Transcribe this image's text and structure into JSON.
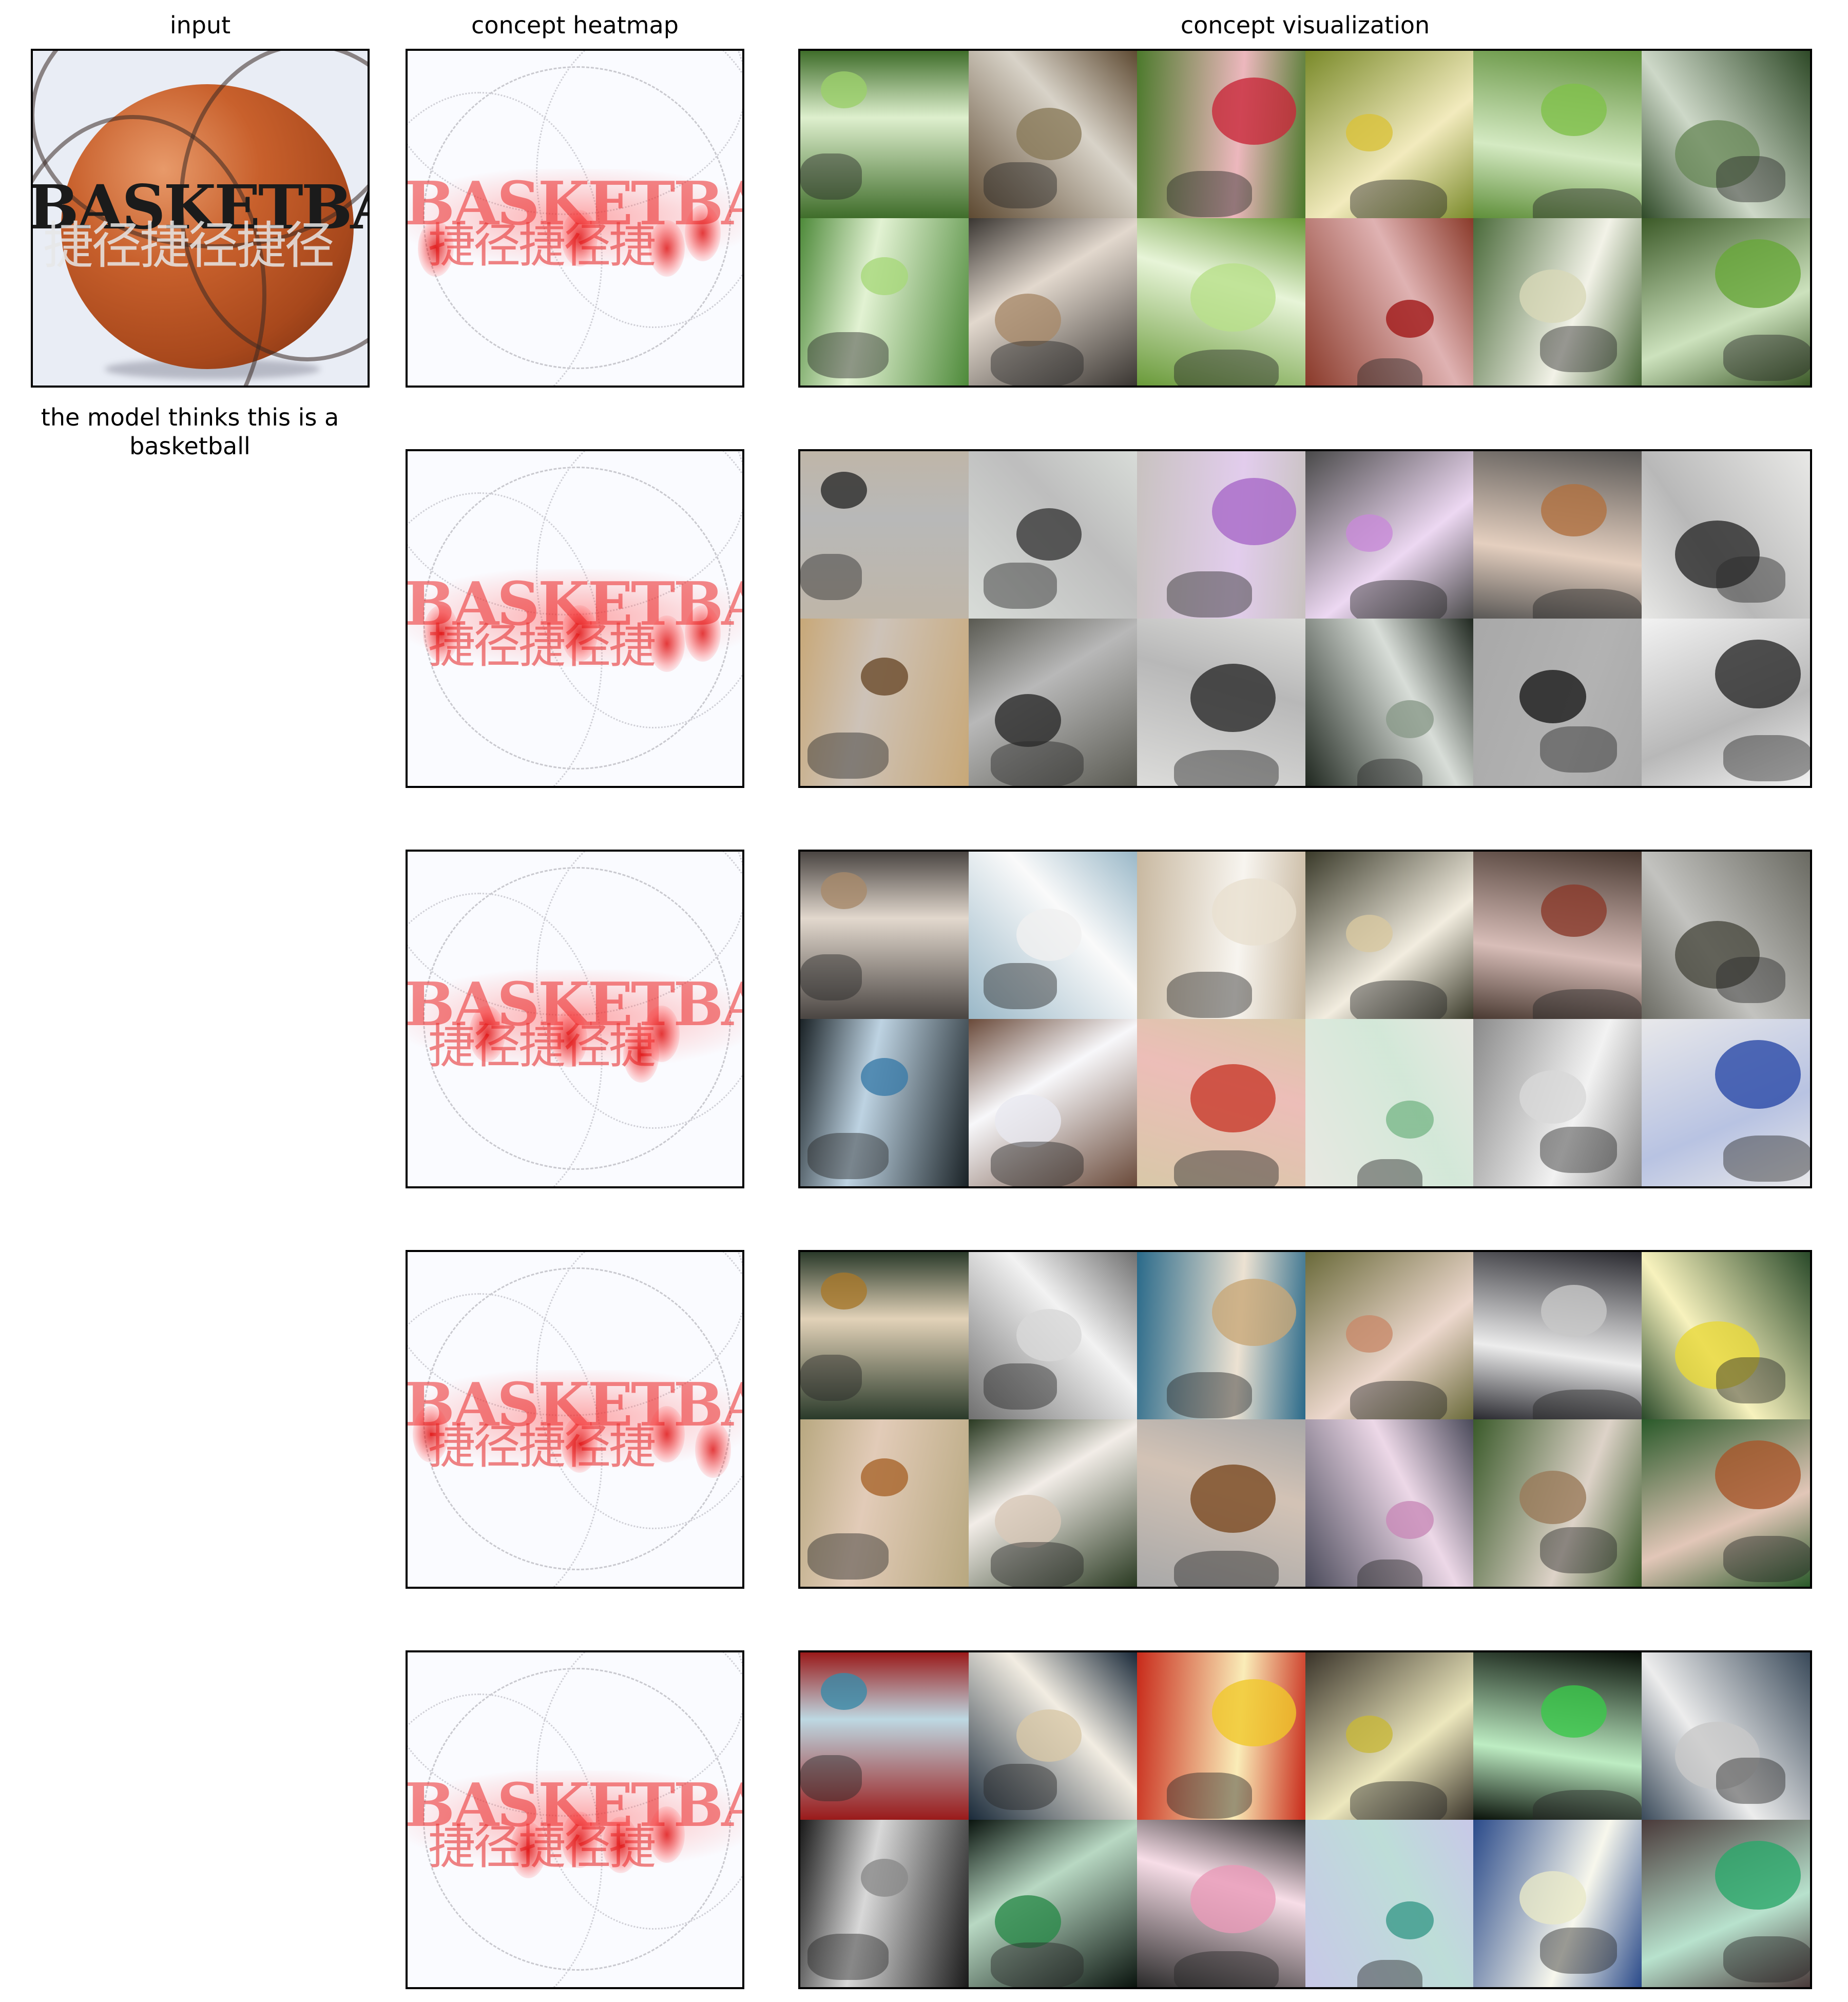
{
  "titles": {
    "input": "input",
    "heatmap": "concept heatmap",
    "visualization": "concept visualization"
  },
  "caption": "the model thinks this is a basketball",
  "input_image": {
    "overlay_word": "BASKETBALL",
    "overlay_cjk": "捷径捷径捷径"
  },
  "heatmap_overlay": {
    "word": "BASKETBALL",
    "cjk": "捷径捷径捷"
  },
  "rows": [
    {
      "theme": "garden-vegetables",
      "colors": [
        "#3f6d2a",
        "#5e4a32",
        "#4c7a2c",
        "#7a8a2a",
        "#5f8f3a",
        "#2f4a28",
        "#4e8a3a",
        "#3a3632",
        "#6a9a3a",
        "#8a3a2a",
        "#4a6a3a",
        "#3c5a28"
      ],
      "accents": [
        "#9bd06a",
        "#8a7a5a",
        "#c8283a",
        "#d9c23a",
        "#7fc04a",
        "#6a8a5a",
        "#a8d87a",
        "#a88a6a",
        "#b8e08a",
        "#a01818",
        "#d8d8b8",
        "#68a83a"
      ]
    },
    {
      "theme": "crossword-puzzles",
      "colors": [
        "#bfb6a8",
        "#d8dcd8",
        "#c8c2c0",
        "#4a4a4a",
        "#5a5856",
        "#e8e8e6",
        "#c8a878",
        "#5a5a52",
        "#dcdcda",
        "#202820",
        "#a8a8a8",
        "#f2f2f2"
      ],
      "accents": [
        "#2a2a2a",
        "#3a3a3a",
        "#a868c8",
        "#c88ad8",
        "#b07040",
        "#2a2a2a",
        "#6a4a2a",
        "#2a2a2a",
        "#2a2a2a",
        "#8a9a8a",
        "#1a1a1a",
        "#2a2a2a"
      ]
    },
    {
      "theme": "cabinets-and-boxes",
      "colors": [
        "#4a4542",
        "#9ab8c8",
        "#c8b8a0",
        "#3a3a2a",
        "#4a3a32",
        "#6a6a62",
        "#1a2226",
        "#6a4a3a",
        "#d8c8a8",
        "#e8e8e2",
        "#8a8a8a",
        "#e8e8ea"
      ],
      "accents": [
        "#a88a6a",
        "#f0f0f0",
        "#e8e0d0",
        "#d8c8a0",
        "#8a3a2a",
        "#4a4a40",
        "#3a7aa8",
        "#e8e8f0",
        "#c83a2a",
        "#7ab88a",
        "#d8d8d8",
        "#2a4aa8"
      ]
    },
    {
      "theme": "orb-weaver-spiders",
      "colors": [
        "#2a3a2a",
        "#707070",
        "#2a6a8a",
        "#6a6a3a",
        "#2a2a30",
        "#2a4a2a",
        "#b8a880",
        "#2a3a22",
        "#a8a8a8",
        "#4a4a5a",
        "#3a5a2a",
        "#2a5a2a"
      ],
      "accents": [
        "#a8782a",
        "#d8d8d8",
        "#c8a878",
        "#c88a6a",
        "#c8c8c8",
        "#e8d83a",
        "#a8642a",
        "#d8c8b8",
        "#7a4a22",
        "#c88ab8",
        "#9a7a5a",
        "#a8562a"
      ]
    },
    {
      "theme": "misc-scenes",
      "colors": [
        "#9a1a1a",
        "#1a2a3a",
        "#c82a1a",
        "#3a342a",
        "#0a120a",
        "#3a4a5a",
        "#1a1a1a",
        "#0a140e",
        "#2a2a2a",
        "#c8c8e8",
        "#2a4a8a",
        "#4a3a3a"
      ],
      "accents": [
        "#3a8aa8",
        "#d8c8a8",
        "#f0c82a",
        "#c8b83a",
        "#3ac84a",
        "#c8c8c8",
        "#8a8a8a",
        "#2a8a4a",
        "#e89ab8",
        "#3a9a8a",
        "#e8e8c8",
        "#2aa86a"
      ]
    }
  ]
}
